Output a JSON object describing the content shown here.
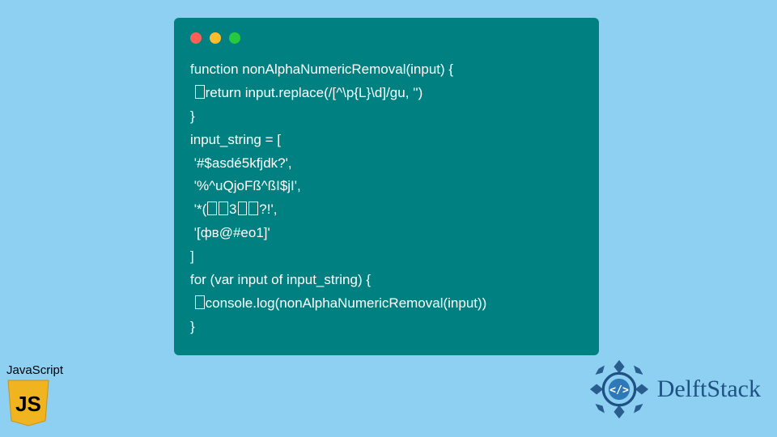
{
  "code": {
    "lines": [
      "function nonAlphaNumericRemoval(input) {",
      " ☐return input.replace(/[^\\p{L}\\d]/gu, '')",
      "}",
      "input_string = [",
      " '#$asdé5kfjdk?',",
      " '%^uQjoFß^ßI$jI',",
      " '*(☐☐3☐☐?!',",
      " '[фв@#eo1]'",
      "]",
      "for (var input of input_string) {",
      " ☐console.log(nonAlphaNumericRemoval(input))",
      "}"
    ]
  },
  "js_badge": {
    "label": "JavaScript",
    "shield_text": "JS"
  },
  "brand": {
    "name": "DelftStack"
  },
  "colors": {
    "page_bg": "#8ed0f2",
    "code_bg": "#008080",
    "code_fg": "#ffffff",
    "js_shield": "#f0b421",
    "brand": "#1e5184"
  }
}
